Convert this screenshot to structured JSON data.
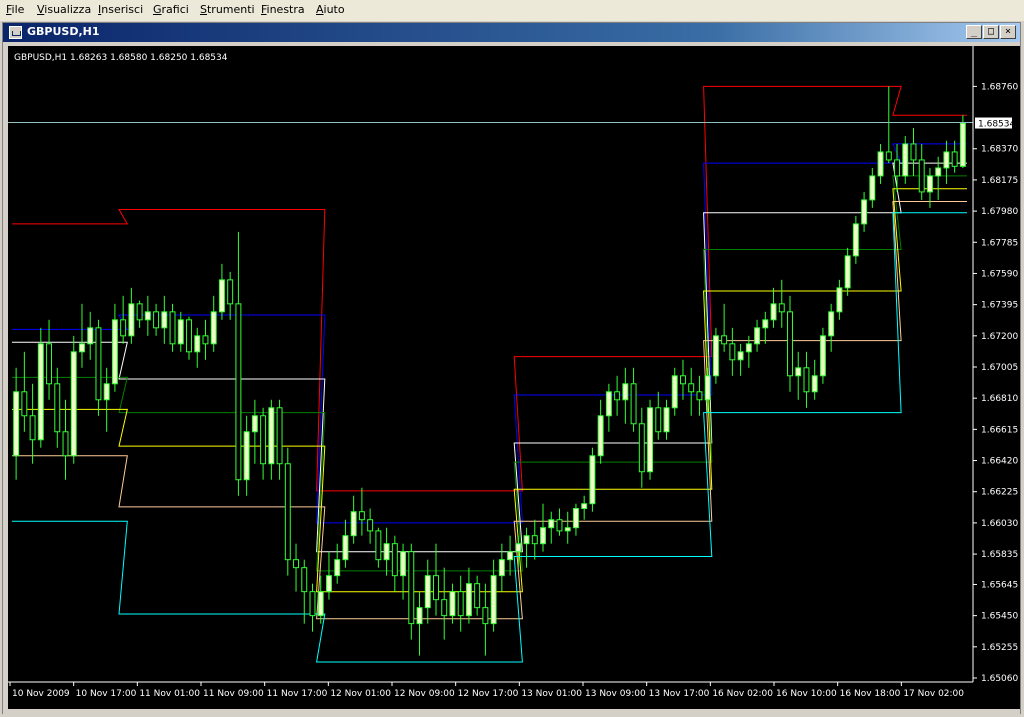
{
  "menu": {
    "items": [
      {
        "label": "File",
        "u": "F",
        "rest": "ile"
      },
      {
        "label": "Visualizza",
        "u": "V",
        "rest": "isualizza"
      },
      {
        "label": "Inserisci",
        "u": "I",
        "rest": "nserisci"
      },
      {
        "label": "Grafici",
        "u": "G",
        "rest": "rafici"
      },
      {
        "label": "Strumenti",
        "u": "S",
        "rest": "trumenti"
      },
      {
        "label": "Finestra",
        "u": "F",
        "rest": "inestra"
      },
      {
        "label": "Aiuto",
        "u": "A",
        "rest": "iuto"
      }
    ]
  },
  "window": {
    "title": "GBPUSD,H1",
    "minimize": "_",
    "maximize": "□",
    "close": "×"
  },
  "chart_info": "GBPUSD,H1  1.68263 1.68580 1.68250 1.68534",
  "chart_data": {
    "type": "candlestick",
    "symbol": "GBPUSD",
    "timeframe": "H1",
    "ohlc": [
      1.68263,
      1.6858,
      1.6825,
      1.68534
    ],
    "current_price": "1.68534",
    "colors": {
      "background": "#000000",
      "bull_body": "#f0ffc8",
      "bear_body": "#000000",
      "wick": "#33ff33",
      "axis": "#ffffff",
      "current_line": "#8fbfbf",
      "price_tag": "#ffffff"
    },
    "y_ticks": [
      "1.68760",
      "1.68370",
      "1.68175",
      "1.67980",
      "1.67785",
      "1.67590",
      "1.67395",
      "1.67200",
      "1.67005",
      "1.66810",
      "1.66615",
      "1.66420",
      "1.66225",
      "1.66030",
      "1.65835",
      "1.65645",
      "1.65450",
      "1.65255",
      "1.65060"
    ],
    "y_values": [
      1.6876,
      1.6837,
      1.68175,
      1.6798,
      1.67785,
      1.6759,
      1.67395,
      1.672,
      1.67005,
      1.6681,
      1.66615,
      1.6642,
      1.66225,
      1.6603,
      1.65835,
      1.65645,
      1.6545,
      1.65255,
      1.6506
    ],
    "ylim": [
      1.6506,
      1.6895
    ],
    "x_ticks": [
      "10 Nov 2009",
      "10 Nov 17:00",
      "11 Nov 01:00",
      "11 Nov 09:00",
      "11 Nov 17:00",
      "12 Nov 01:00",
      "12 Nov 09:00",
      "12 Nov 17:00",
      "13 Nov 01:00",
      "13 Nov 09:00",
      "13 Nov 17:00",
      "16 Nov 02:00",
      "16 Nov 10:00",
      "16 Nov 18:00",
      "17 Nov 02:00"
    ],
    "pivot_colors": [
      "#ff0000",
      "#0000ff",
      "#ffffff",
      "#008000",
      "#ffff00",
      "#ffcc99",
      "#00ffff"
    ],
    "pivot_levels": [
      {
        "days": [
          0,
          13
        ],
        "values": [
          1.679,
          1.6724,
          1.6716,
          1.6694,
          1.6674,
          1.6645,
          1.6604
        ]
      },
      {
        "days": [
          14,
          37
        ],
        "values": [
          1.6799,
          1.6733,
          1.6693,
          1.6672,
          1.6651,
          1.6613,
          1.6546
        ]
      },
      {
        "days": [
          38,
          61
        ],
        "values": [
          1.6623,
          1.6603,
          1.6585,
          1.6573,
          1.656,
          1.6543,
          1.6516
        ]
      },
      {
        "days": [
          62,
          84
        ],
        "values": [
          1.6707,
          1.6683,
          1.6653,
          1.6641,
          1.6624,
          1.6604,
          1.6582
        ]
      },
      {
        "days": [
          85,
          107
        ],
        "values": [
          1.6876,
          1.6828,
          1.6797,
          1.6774,
          1.6748,
          1.6717,
          1.6672
        ]
      },
      {
        "days": [
          108,
          115
        ],
        "values": [
          1.6858,
          1.684,
          1.6828,
          1.682,
          1.6812,
          1.6804,
          1.6797
        ]
      }
    ],
    "candles": [
      [
        1.6645,
        1.67,
        1.663,
        1.6685
      ],
      [
        1.6685,
        1.671,
        1.666,
        1.667
      ],
      [
        1.667,
        1.669,
        1.664,
        1.6655
      ],
      [
        1.6655,
        1.6725,
        1.665,
        1.6715
      ],
      [
        1.6715,
        1.673,
        1.668,
        1.669
      ],
      [
        1.669,
        1.67,
        1.665,
        1.666
      ],
      [
        1.666,
        1.668,
        1.663,
        1.6645
      ],
      [
        1.6645,
        1.672,
        1.664,
        1.671
      ],
      [
        1.671,
        1.674,
        1.67,
        1.6715
      ],
      [
        1.6715,
        1.6735,
        1.6705,
        1.6725
      ],
      [
        1.6725,
        1.673,
        1.667,
        1.668
      ],
      [
        1.668,
        1.67,
        1.666,
        1.669
      ],
      [
        1.669,
        1.674,
        1.6685,
        1.673
      ],
      [
        1.673,
        1.6745,
        1.6715,
        1.672
      ],
      [
        1.672,
        1.675,
        1.6715,
        1.674
      ],
      [
        1.674,
        1.6742,
        1.6725,
        1.673
      ],
      [
        1.673,
        1.6745,
        1.672,
        1.6735
      ],
      [
        1.6735,
        1.674,
        1.672,
        1.6725
      ],
      [
        1.6725,
        1.6745,
        1.6715,
        1.6735
      ],
      [
        1.6735,
        1.674,
        1.671,
        1.6715
      ],
      [
        1.6715,
        1.6735,
        1.671,
        1.673
      ],
      [
        1.673,
        1.6732,
        1.6705,
        1.671
      ],
      [
        1.671,
        1.6725,
        1.67,
        1.672
      ],
      [
        1.672,
        1.673,
        1.6705,
        1.6715
      ],
      [
        1.6715,
        1.6745,
        1.671,
        1.6735
      ],
      [
        1.6735,
        1.6765,
        1.673,
        1.6755
      ],
      [
        1.6755,
        1.676,
        1.673,
        1.674
      ],
      [
        1.674,
        1.6785,
        1.662,
        1.663
      ],
      [
        1.663,
        1.667,
        1.662,
        1.666
      ],
      [
        1.666,
        1.668,
        1.664,
        1.667
      ],
      [
        1.667,
        1.6675,
        1.663,
        1.664
      ],
      [
        1.664,
        1.668,
        1.663,
        1.6675
      ],
      [
        1.6675,
        1.668,
        1.663,
        1.664
      ],
      [
        1.664,
        1.665,
        1.657,
        1.658
      ],
      [
        1.658,
        1.659,
        1.656,
        1.6575
      ],
      [
        1.6575,
        1.658,
        1.654,
        1.656
      ],
      [
        1.656,
        1.6565,
        1.6535,
        1.6545
      ],
      [
        1.6545,
        1.657,
        1.654,
        1.656
      ],
      [
        1.656,
        1.6585,
        1.6555,
        1.657
      ],
      [
        1.657,
        1.659,
        1.6565,
        1.658
      ],
      [
        1.658,
        1.6605,
        1.6575,
        1.6595
      ],
      [
        1.6595,
        1.662,
        1.659,
        1.661
      ],
      [
        1.661,
        1.6625,
        1.6595,
        1.6605
      ],
      [
        1.6605,
        1.6612,
        1.659,
        1.6598
      ],
      [
        1.6598,
        1.66,
        1.6575,
        1.658
      ],
      [
        1.658,
        1.66,
        1.657,
        1.659
      ],
      [
        1.659,
        1.6595,
        1.656,
        1.657
      ],
      [
        1.657,
        1.659,
        1.6555,
        1.6585
      ],
      [
        1.6585,
        1.659,
        1.653,
        1.654
      ],
      [
        1.654,
        1.656,
        1.652,
        1.655
      ],
      [
        1.655,
        1.658,
        1.654,
        1.657
      ],
      [
        1.657,
        1.659,
        1.6545,
        1.6555
      ],
      [
        1.6555,
        1.6575,
        1.653,
        1.6545
      ],
      [
        1.6545,
        1.6565,
        1.654,
        1.656
      ],
      [
        1.656,
        1.657,
        1.6535,
        1.6545
      ],
      [
        1.6545,
        1.6575,
        1.654,
        1.6565
      ],
      [
        1.6565,
        1.657,
        1.6545,
        1.655
      ],
      [
        1.655,
        1.6565,
        1.652,
        1.654
      ],
      [
        1.654,
        1.658,
        1.6535,
        1.657
      ],
      [
        1.657,
        1.659,
        1.656,
        1.658
      ],
      [
        1.658,
        1.6595,
        1.657,
        1.6585
      ],
      [
        1.6585,
        1.6595,
        1.6575,
        1.659
      ],
      [
        1.659,
        1.66,
        1.6575,
        1.6595
      ],
      [
        1.6595,
        1.6605,
        1.658,
        1.659
      ],
      [
        1.659,
        1.6615,
        1.6585,
        1.66
      ],
      [
        1.66,
        1.661,
        1.659,
        1.6605
      ],
      [
        1.6605,
        1.6612,
        1.6595,
        1.6598
      ],
      [
        1.6598,
        1.661,
        1.659,
        1.66
      ],
      [
        1.66,
        1.6615,
        1.6595,
        1.6612
      ],
      [
        1.6612,
        1.662,
        1.6605,
        1.6615
      ],
      [
        1.6615,
        1.665,
        1.661,
        1.6645
      ],
      [
        1.6645,
        1.668,
        1.664,
        1.667
      ],
      [
        1.667,
        1.669,
        1.666,
        1.6685
      ],
      [
        1.6685,
        1.6695,
        1.667,
        1.668
      ],
      [
        1.668,
        1.67,
        1.6665,
        1.669
      ],
      [
        1.669,
        1.67,
        1.666,
        1.6665
      ],
      [
        1.6665,
        1.6675,
        1.6625,
        1.6635
      ],
      [
        1.6635,
        1.668,
        1.663,
        1.6675
      ],
      [
        1.6675,
        1.6685,
        1.6655,
        1.666
      ],
      [
        1.666,
        1.668,
        1.6655,
        1.6675
      ],
      [
        1.6675,
        1.67,
        1.667,
        1.6695
      ],
      [
        1.6695,
        1.6705,
        1.668,
        1.669
      ],
      [
        1.669,
        1.67,
        1.667,
        1.6685
      ],
      [
        1.6685,
        1.6695,
        1.667,
        1.668
      ],
      [
        1.668,
        1.67,
        1.6672,
        1.6695
      ],
      [
        1.6695,
        1.6725,
        1.669,
        1.672
      ],
      [
        1.672,
        1.674,
        1.671,
        1.6715
      ],
      [
        1.6715,
        1.6725,
        1.6695,
        1.6705
      ],
      [
        1.6705,
        1.6715,
        1.6695,
        1.671
      ],
      [
        1.671,
        1.672,
        1.67,
        1.6715
      ],
      [
        1.6715,
        1.673,
        1.671,
        1.6725
      ],
      [
        1.6725,
        1.6735,
        1.6715,
        1.673
      ],
      [
        1.673,
        1.675,
        1.6725,
        1.674
      ],
      [
        1.674,
        1.6755,
        1.6725,
        1.6735
      ],
      [
        1.6735,
        1.6745,
        1.6685,
        1.6695
      ],
      [
        1.6695,
        1.671,
        1.668,
        1.67
      ],
      [
        1.67,
        1.671,
        1.6675,
        1.6685
      ],
      [
        1.6685,
        1.6705,
        1.668,
        1.6695
      ],
      [
        1.6695,
        1.6725,
        1.669,
        1.672
      ],
      [
        1.672,
        1.674,
        1.671,
        1.6735
      ],
      [
        1.6735,
        1.6755,
        1.673,
        1.675
      ],
      [
        1.675,
        1.6775,
        1.6745,
        1.677
      ],
      [
        1.677,
        1.6795,
        1.6765,
        1.679
      ],
      [
        1.679,
        1.681,
        1.6785,
        1.6805
      ],
      [
        1.6805,
        1.6825,
        1.68,
        1.682
      ],
      [
        1.682,
        1.684,
        1.6815,
        1.6835
      ],
      [
        1.6835,
        1.6876,
        1.6828,
        1.683
      ],
      [
        1.683,
        1.684,
        1.681,
        1.682
      ],
      [
        1.682,
        1.6845,
        1.6815,
        1.684
      ],
      [
        1.684,
        1.685,
        1.682,
        1.683
      ],
      [
        1.683,
        1.684,
        1.6805,
        1.681
      ],
      [
        1.681,
        1.6825,
        1.68,
        1.682
      ],
      [
        1.682,
        1.6832,
        1.6805,
        1.6825
      ],
      [
        1.6825,
        1.6842,
        1.6815,
        1.6835
      ],
      [
        1.6835,
        1.6842,
        1.6822,
        1.6826
      ],
      [
        1.6826,
        1.6858,
        1.6825,
        1.6853
      ]
    ]
  }
}
